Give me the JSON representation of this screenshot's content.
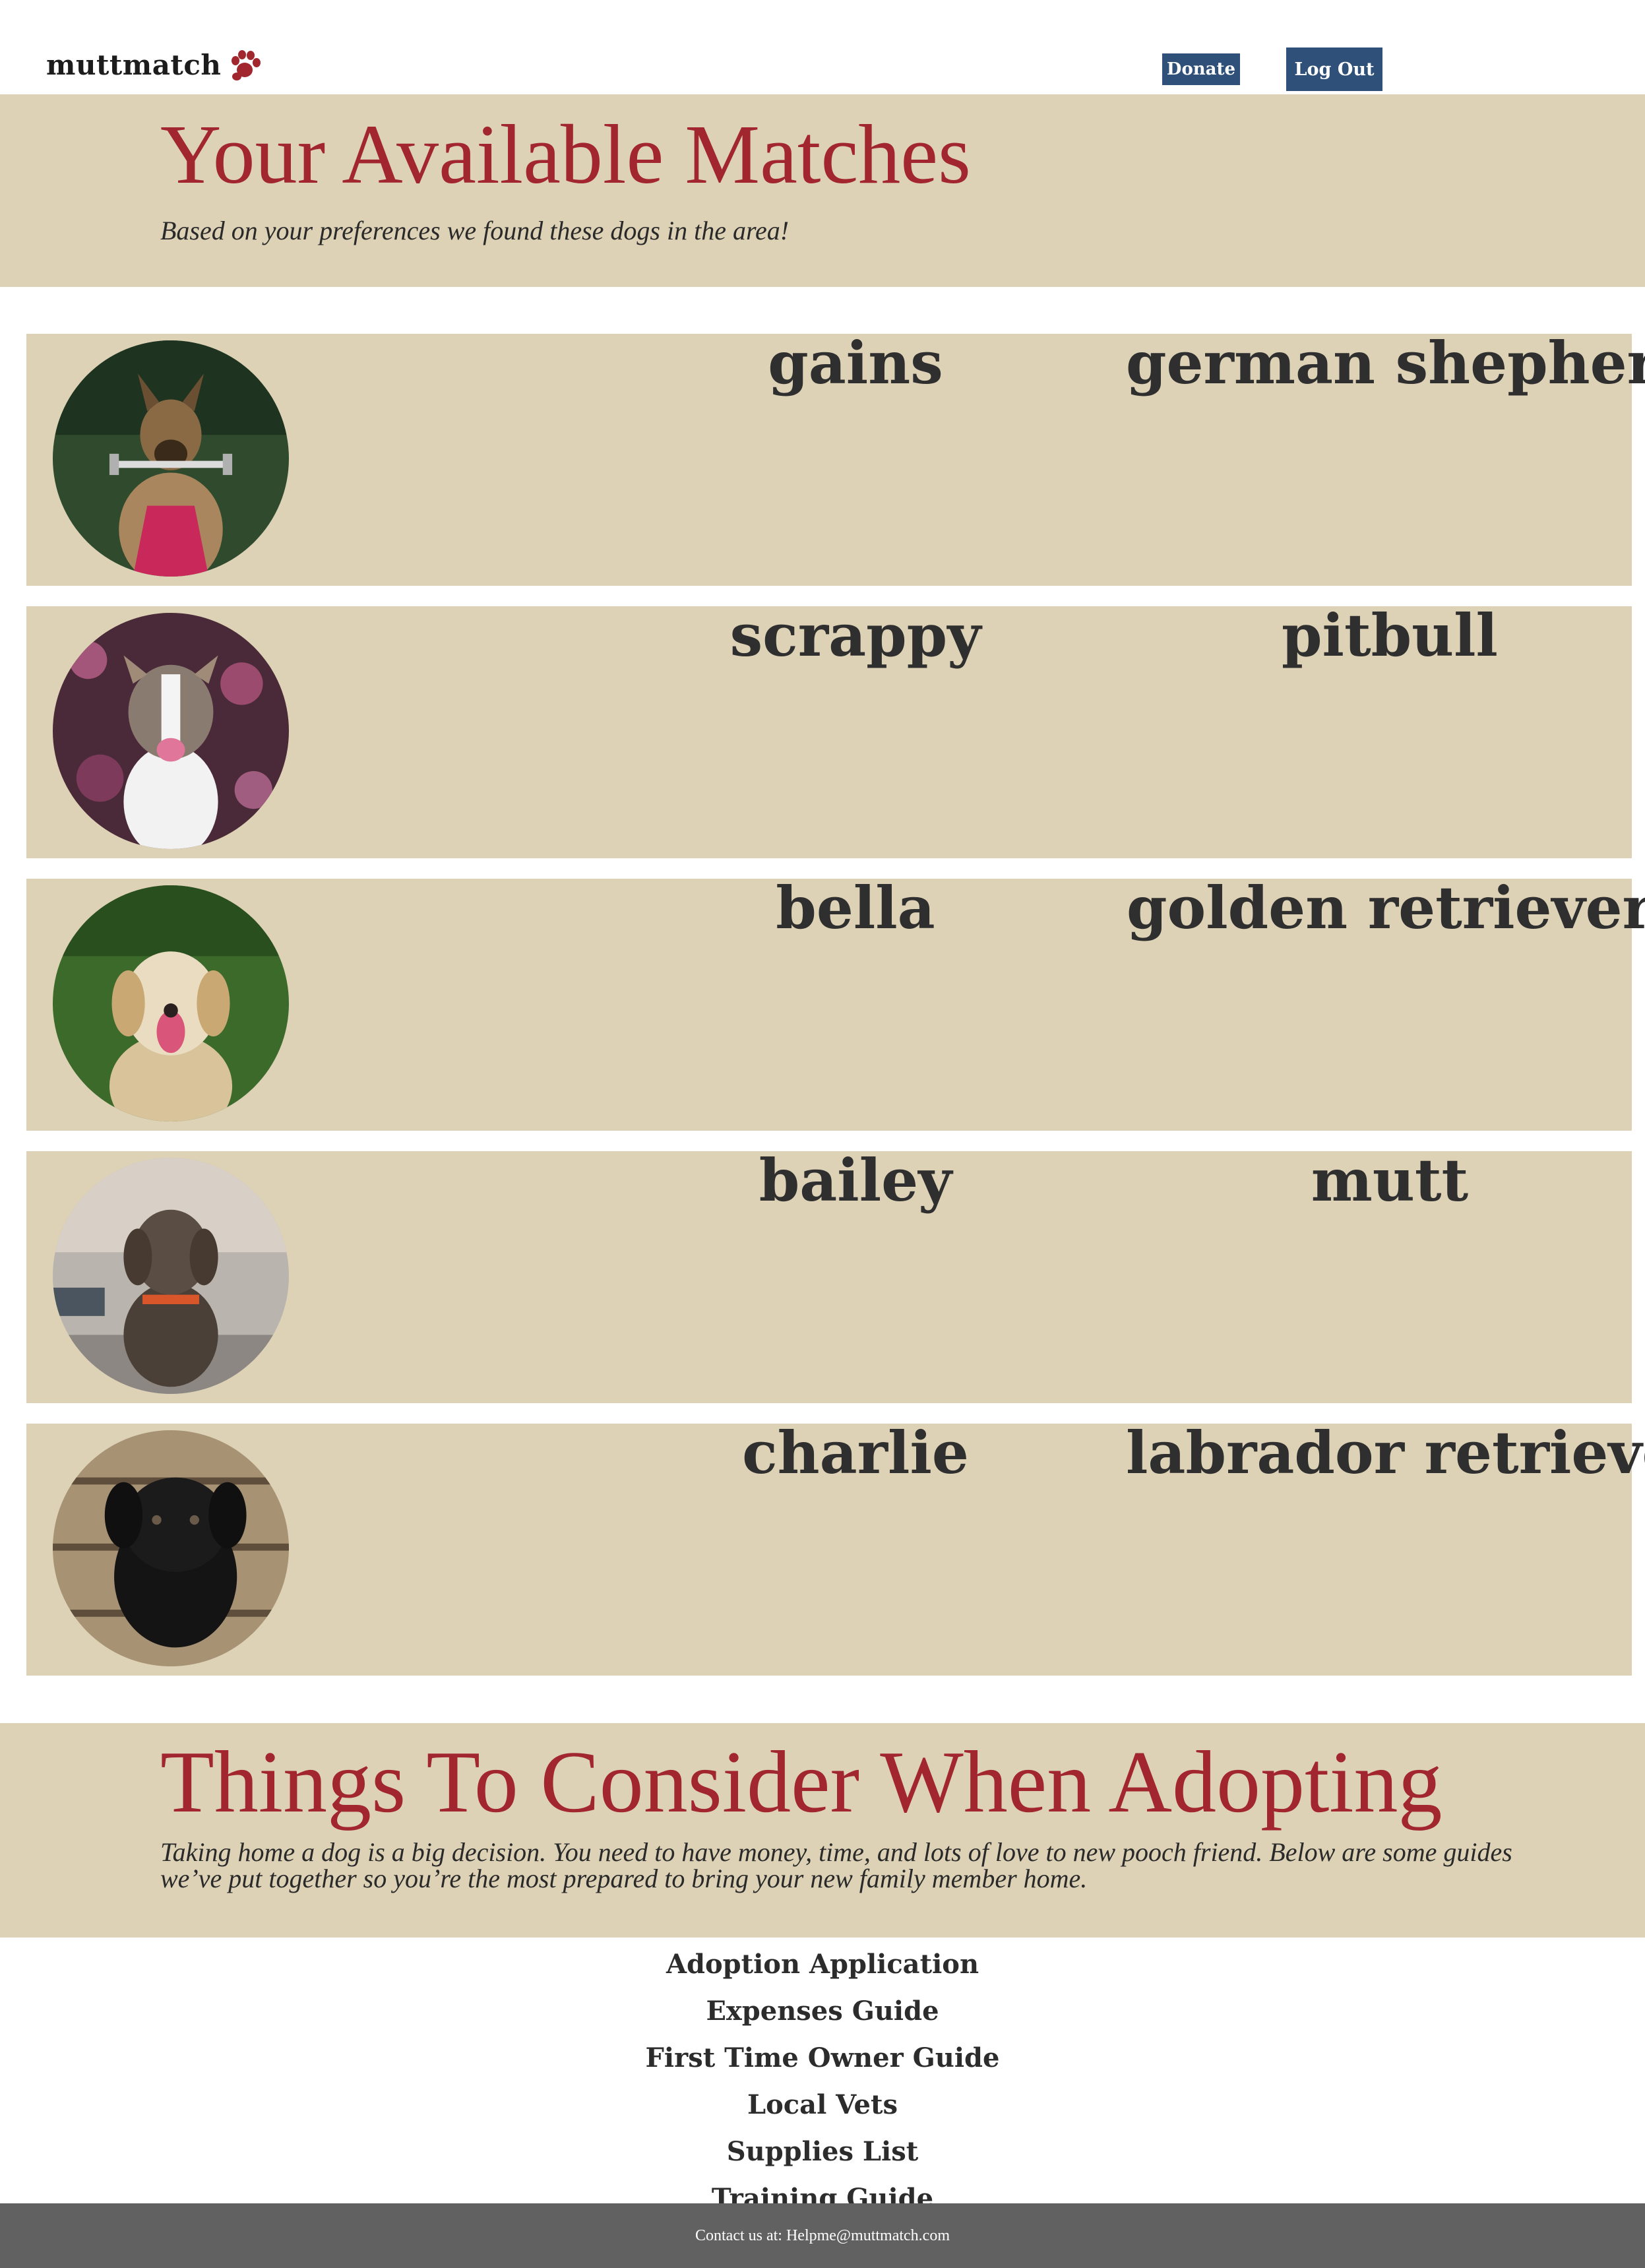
{
  "header": {
    "brand": "muttmatch",
    "donate_label": "Donate",
    "logout_label": "Log Out",
    "button_color": "#2e5079",
    "logo_color": "#a1262e"
  },
  "hero": {
    "title": "Your Available Matches",
    "subtitle": "Based on your preferences we found these dogs in the area!",
    "title_color": "#a1262e",
    "background": "#ddd2b6"
  },
  "matches": [
    {
      "name": "gains",
      "breed": "german shepherd",
      "photo_icon": "dog-photo-german-shepherd"
    },
    {
      "name": "scrappy",
      "breed": "pitbull",
      "photo_icon": "dog-photo-pitbull"
    },
    {
      "name": "bella",
      "breed": "golden retriever",
      "photo_icon": "dog-photo-golden-retriever"
    },
    {
      "name": "bailey",
      "breed": "mutt",
      "photo_icon": "dog-photo-mutt"
    },
    {
      "name": "charlie",
      "breed": "labrador retriever",
      "photo_icon": "dog-photo-labrador"
    }
  ],
  "consider": {
    "title": "Things To Consider When Adopting",
    "body": "Taking home a dog is a big decision. You need to have money, time, and lots of love to new pooch friend. Below are some guides we’ve put together so you’re the most prepared to bring your new family member home."
  },
  "guides": [
    "Adoption Application",
    "Expenses Guide",
    "First Time Owner Guide",
    "Local Vets",
    "Supplies List",
    "Training Guide"
  ],
  "footer": {
    "contact": "Contact us at: Helpme@muttmatch.com",
    "background": "#616161"
  }
}
